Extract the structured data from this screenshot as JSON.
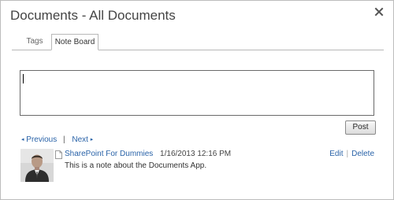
{
  "dialog": {
    "title": "Documents - All Documents"
  },
  "tabs": [
    {
      "label": "Tags"
    },
    {
      "label": "Note Board"
    }
  ],
  "note_input": {
    "value": ""
  },
  "post_button": {
    "label": "Post"
  },
  "pager": {
    "previous_label": "Previous",
    "separator": "|",
    "next_label": "Next"
  },
  "note": {
    "author_link": "SharePoint For Dummies",
    "timestamp": "1/16/2013 12:16 PM",
    "text": "This is a note about the Documents App.",
    "edit_label": "Edit",
    "separator": "|",
    "delete_label": "Delete"
  },
  "colors": {
    "link": "#2a63a8",
    "border": "#bcbcbc",
    "text": "#444444"
  },
  "icons": {
    "close": "close-icon",
    "prev": "chevron-left-icon",
    "next": "chevron-right-icon",
    "doc": "document-icon"
  }
}
